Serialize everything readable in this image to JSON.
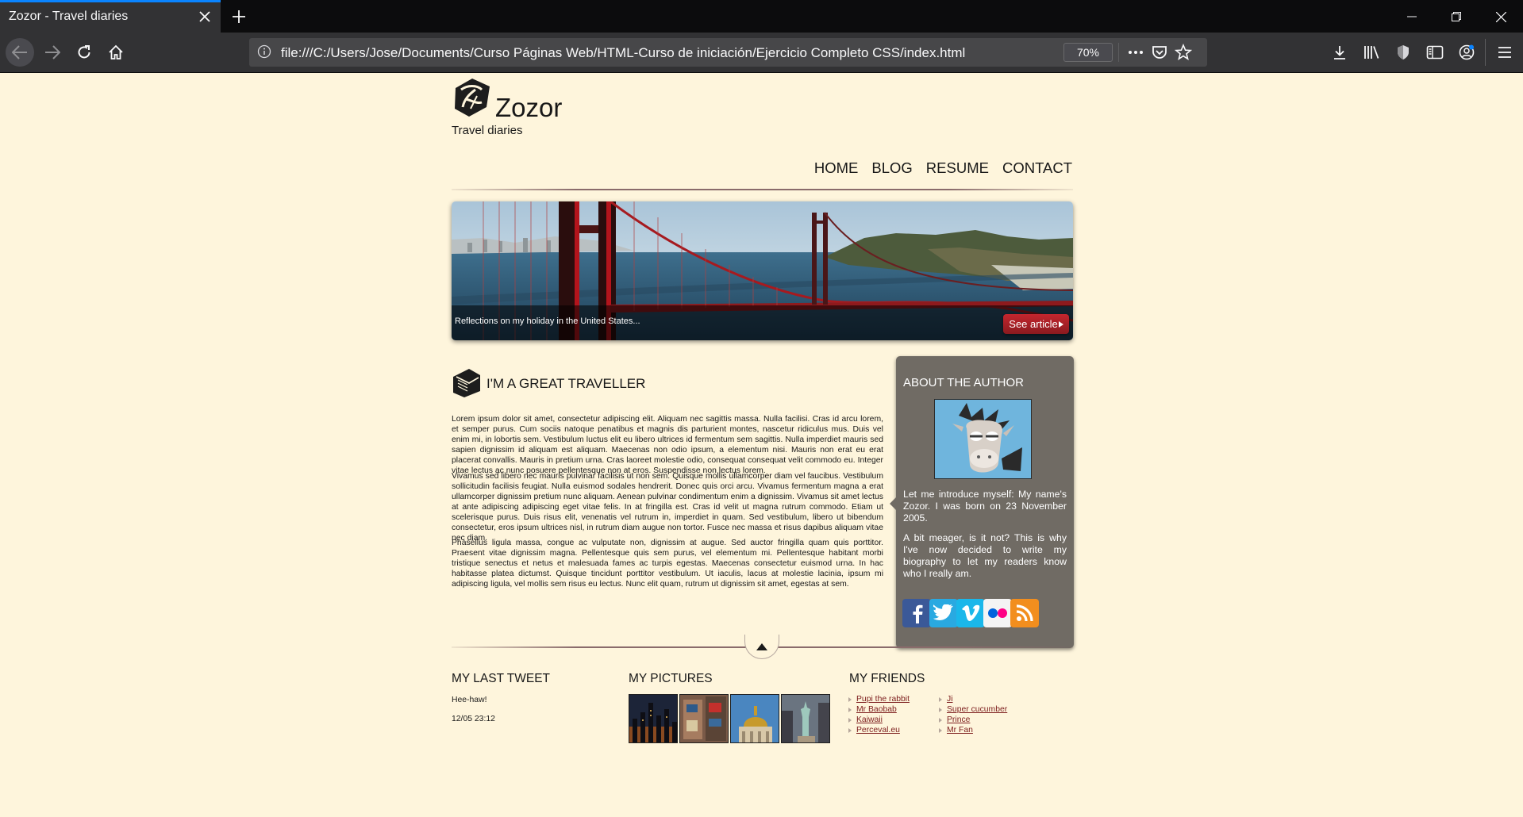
{
  "browser": {
    "tab_title": "Zozor - Travel diaries",
    "url": "file:///C:/Users/Jose/Documents/Curso Páginas Web/HTML-Curso de iniciación/Ejercicio Completo CSS/index.html",
    "zoom": "70%"
  },
  "site": {
    "name": "Zozor",
    "tagline": "Travel diaries"
  },
  "nav": [
    "HOME",
    "BLOG",
    "RESUME",
    "CONTACT"
  ],
  "banner": {
    "caption": "Reflections on my holiday in the United States...",
    "button": "See article"
  },
  "article": {
    "title": "I'M A GREAT TRAVELLER",
    "paragraphs": [
      "Lorem ipsum dolor sit amet, consectetur adipiscing elit. Aliquam nec sagittis massa. Nulla facilisi. Cras id arcu lorem, et semper purus. Cum sociis natoque penatibus et magnis dis parturient montes, nascetur ridiculus mus. Duis vel enim mi, in lobortis sem. Vestibulum luctus elit eu libero ultrices id fermentum sem sagittis. Nulla imperdiet mauris sed sapien dignissim id aliquam est aliquam. Maecenas non odio ipsum, a elementum nisi. Mauris non erat eu erat placerat convallis. Mauris in pretium urna. Cras laoreet molestie odio, consequat consequat velit commodo eu. Integer vitae lectus ac nunc posuere pellentesque non at eros. Suspendisse non lectus lorem.",
      "Vivamus sed libero nec mauris pulvinar facilisis ut non sem. Quisque mollis ullamcorper diam vel faucibus. Vestibulum sollicitudin facilisis feugiat. Nulla euismod sodales hendrerit. Donec quis orci arcu. Vivamus fermentum magna a erat ullamcorper dignissim pretium nunc aliquam. Aenean pulvinar condimentum enim a dignissim. Vivamus sit amet lectus at ante adipiscing adipiscing eget vitae felis. In at fringilla est. Cras id velit ut magna rutrum commodo. Etiam ut scelerisque purus. Duis risus elit, venenatis vel rutrum in, imperdiet in quam. Sed vestibulum, libero ut bibendum consectetur, eros ipsum ultrices nisl, in rutrum diam augue non tortor. Fusce nec massa et risus dapibus aliquam vitae nec diam.",
      "Phasellus ligula massa, congue ac vulputate non, dignissim at augue. Sed auctor fringilla quam quis porttitor. Praesent vitae dignissim magna. Pellentesque quis sem purus, vel elementum mi. Pellentesque habitant morbi tristique senectus et netus et malesuada fames ac turpis egestas. Maecenas consectetur euismod urna. In hac habitasse platea dictumst. Quisque tincidunt porttitor vestibulum. Ut iaculis, lacus at molestie lacinia, ipsum mi adipiscing ligula, vel mollis sem risus eu lectus. Nunc elit quam, rutrum ut dignissim sit amet, egestas at sem."
    ]
  },
  "aside": {
    "title": "ABOUT THE AUTHOR",
    "paragraphs": [
      "Let me introduce myself: My name's Zozor. I was born on 23 November 2005.",
      "A bit meager, is it not? This is why I've now decided to write my biography to let my readers know who I really am."
    ],
    "social": [
      "facebook-icon",
      "twitter-icon",
      "vimeo-icon",
      "flickr-icon",
      "rss-icon"
    ]
  },
  "footer": {
    "tweet": {
      "title": "MY LAST TWEET",
      "text": "Hee-haw!",
      "date": "12/05 23:12"
    },
    "pictures": {
      "title": "MY PICTURES"
    },
    "friends": {
      "title": "MY FRIENDS",
      "col1": [
        "Pupi the rabbit",
        "Mr Baobab",
        "Kaiwaii",
        "Perceval.eu"
      ],
      "col2": [
        "Ji",
        "Super cucumber",
        "Prince",
        "Mr Fan"
      ]
    }
  },
  "colors": {
    "page_bg": "#fef5dc",
    "aside_bg": "#706b64",
    "button_red": "#c4262e",
    "friend_link": "#7c1c1c",
    "tab_accent": "#0a84ff"
  }
}
